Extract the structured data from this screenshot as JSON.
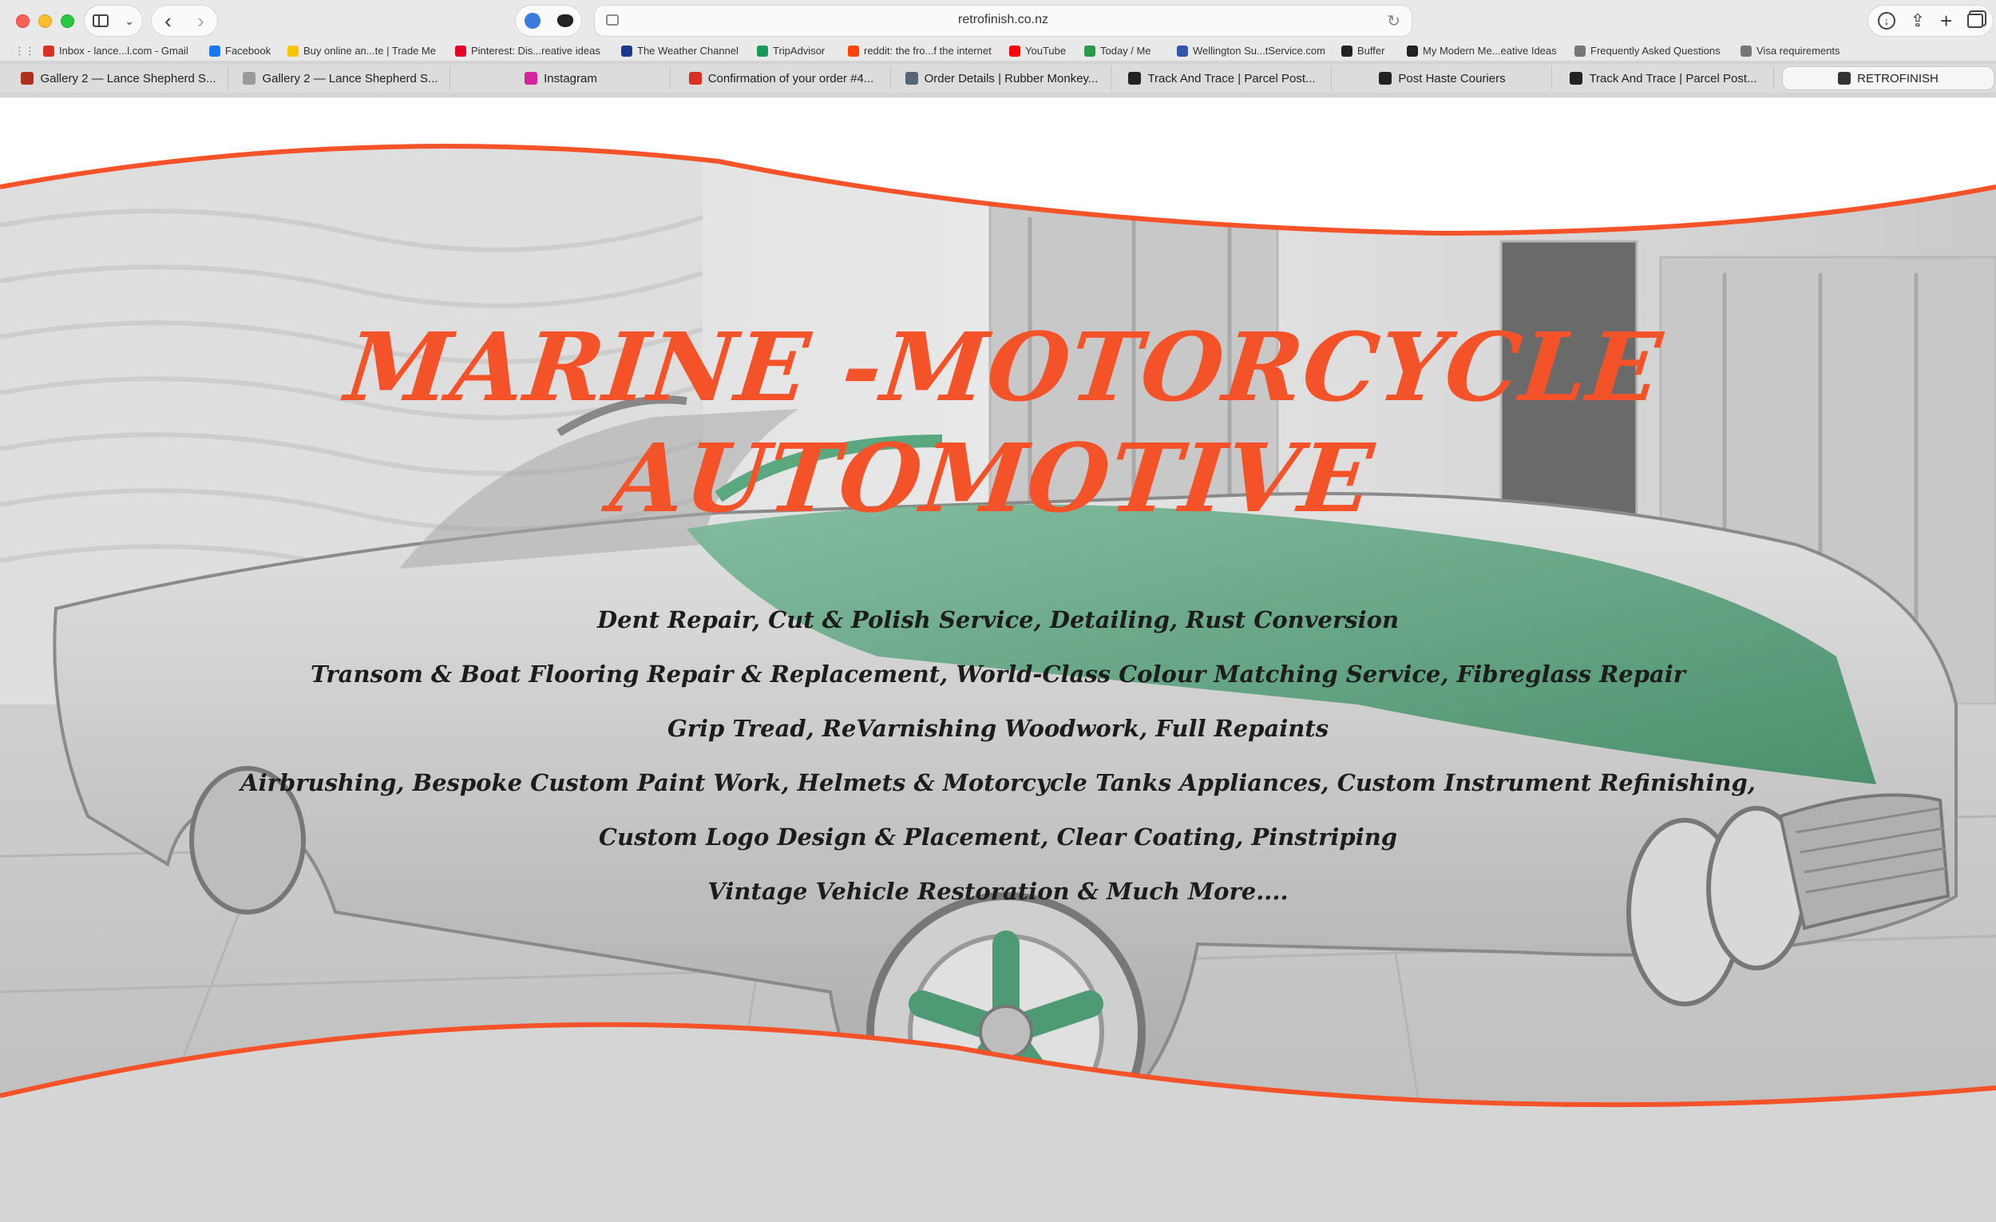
{
  "browser": {
    "url": "retrofinish.co.nz",
    "bookmarks": [
      {
        "label": "Inbox - lance...l.com - Gmail",
        "icon": "gmail-icon",
        "color": "#d93025"
      },
      {
        "label": "Facebook",
        "icon": "facebook-icon",
        "color": "#1877f2"
      },
      {
        "label": "Buy online an...te | Trade Me",
        "icon": "trademe-icon",
        "color": "#f7c600"
      },
      {
        "label": "Pinterest: Dis...reative ideas",
        "icon": "pinterest-icon",
        "color": "#e60023"
      },
      {
        "label": "The Weather Channel",
        "icon": "weather-icon",
        "color": "#1a3a8a"
      },
      {
        "label": "TripAdvisor",
        "icon": "tripadvisor-icon",
        "color": "#1a9a5a"
      },
      {
        "label": "reddit: the fro...f the internet",
        "icon": "reddit-icon",
        "color": "#ff4500"
      },
      {
        "label": "YouTube",
        "icon": "youtube-icon",
        "color": "#ff0000"
      },
      {
        "label": "Today / Me",
        "icon": "today-icon",
        "color": "#2a9a4a"
      },
      {
        "label": "Wellington Su...tService.com",
        "icon": "globe-icon",
        "color": "#3355aa"
      },
      {
        "label": "Buffer",
        "icon": "buffer-icon",
        "color": "#222222"
      },
      {
        "label": "My Modern Me...eative Ideas",
        "icon": "mymodernmet-icon",
        "color": "#222222"
      },
      {
        "label": "Frequently Asked Questions",
        "icon": "globe-icon",
        "color": "#777777"
      },
      {
        "label": "Visa requirements",
        "icon": "globe-icon",
        "color": "#777777"
      }
    ],
    "tabs": [
      {
        "label": "Gallery 2 — Lance Shepherd S...",
        "icon": "gallery-icon",
        "color": "#b03020",
        "active": false
      },
      {
        "label": "Gallery 2 — Lance Shepherd S...",
        "icon": "letter-l-icon",
        "color": "#9a9a9a",
        "active": false
      },
      {
        "label": "Instagram",
        "icon": "instagram-icon",
        "color": "#d6249f",
        "active": false
      },
      {
        "label": "Confirmation of your order #4...",
        "icon": "gmail-icon",
        "color": "#d93025",
        "active": false
      },
      {
        "label": "Order Details | Rubber Monkey...",
        "icon": "rubber-monkey-icon",
        "color": "#556677",
        "active": false
      },
      {
        "label": "Track And Trace | Parcel Post...",
        "icon": "parcel-icon",
        "color": "#222222",
        "active": false
      },
      {
        "label": "Post Haste Couriers",
        "icon": "parcel-icon",
        "color": "#222222",
        "active": false
      },
      {
        "label": "Track And Trace | Parcel Post...",
        "icon": "parcel-icon",
        "color": "#222222",
        "active": false
      },
      {
        "label": "RETROFINISH",
        "icon": "retrofinish-icon",
        "color": "#333333",
        "active": true
      }
    ]
  },
  "hero": {
    "headline": "MARINE -MOTORCYCLE AUTOMOTIVE",
    "accent_color": "#f4532a",
    "services": [
      "Dent Repair, Cut & Polish Service, Detailing, Rust Conversion",
      "Transom & Boat Flooring Repair & Replacement,  World-Class Colour Matching Service, Fibreglass Repair",
      "Grip Tread, ReVarnishing  Woodwork, Full Repaints",
      "Airbrushing, Bespoke Custom Paint Work, Helmets & Motorcycle Tanks Appliances, Custom Instrument Refinishing,",
      "Custom Logo Design & Placement, Clear Coating, Pinstriping",
      "Vintage Vehicle Restoration & Much More...."
    ]
  }
}
